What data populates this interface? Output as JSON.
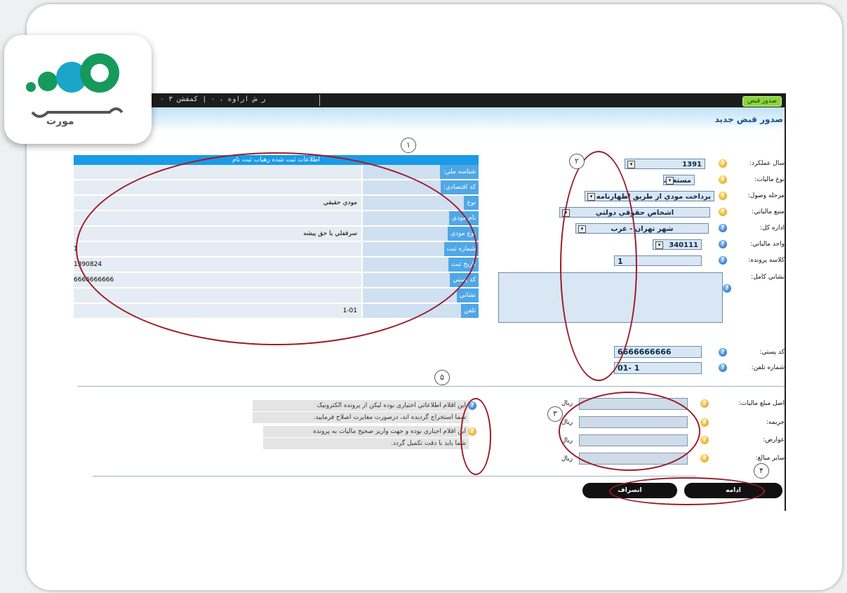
{
  "titlebar": {
    "info": "ﺭ ﺵ ﺍﺭﺍﻭﻩ ، ۰ | ﮐﻤﻔﺸﻦ ۳ ۰"
  },
  "corner_tag": "ﺻﺪﻭﺭ ﻗﺒﺾ",
  "page_title": "ﺻﺪﻭﺭ ﻗﺒﺾ ﺟﺪﻳﺪ",
  "logo": {
    "text": "ﻣﻮﺭﺕ",
    "colors": [
      "#1aa5c9",
      "#159a5b"
    ]
  },
  "form": {
    "fields": [
      {
        "label": "ﺳﺎﻝ ﻋﻤﻠﮑﺮﺩ:",
        "value": "1391"
      },
      {
        "label": "ﻧﻮﻉ ﻣﺎﻟﻴﺎﺕ:",
        "value": "ﻣﺴﺘﻐﻼﺕ"
      },
      {
        "label": "ﻣﺮﺣﻠﻪ ﻭﺻﻮﻝ:",
        "value": "ﭘﺮﺩﺍﺧﺖ ﻣﻮﺩﻱ ﺍﺯ ﻃﺮﻳﻖ ﺍﻇﻬﺎﺭﻧﺎﻣﻪ"
      },
      {
        "label": "ﻣﻨﺒﻊ ﻣﺎﻟﻴﺎﺗﻲ:",
        "value": "ﺍﺷﺨﺎﺹ ﺣﻘﻮﻗﻲ ﺩﻭﻟﺘﻲ"
      },
      {
        "label": "ﺍﺩﺍﺭﻩ ﮐﻞ:",
        "value": "ﺷﻬﺮ ﺗﻬﺮﺍﻥ - ﻏﺮﺏ"
      },
      {
        "label": "ﻭﺍﺣﺪ ﻣﺎﻟﻴﺎﺗﻲ:",
        "value": "340111"
      },
      {
        "label": "ﮐﻼﺳﻪ ﭘﺮﻭﻧﺪﻩ:",
        "value": "1"
      },
      {
        "label": "ﻧﺸﺎﻧﻲ ﮐﺎﻣﻞ:",
        "value": ""
      },
      {
        "label": "ﮐﺪ ﭘﺴﺘﻲ:",
        "value": "6666666666"
      },
      {
        "label": "ﺷﻤﺎﺭﻩ ﺗﻠﻔﻦ:",
        "value": "01- 1"
      }
    ]
  },
  "info_table": {
    "title": "ﺍﻃﻼﻋﺎﺕ ﺛﺒﺖ ﺷﺪﻩ ﺭﻫﻴﺎﺏ ﺛﺒﺖ ﻧﺎﻡ",
    "rows": [
      {
        "key": "ﺷﻨﺎﺳﻪ ﻣﻠﻲ:",
        "value": ""
      },
      {
        "key": "ﮐﺪ ﺍﻗﺘﺼﺎﺩﻱ:",
        "value": ""
      },
      {
        "key": "ﻧﻮﻉ",
        "value": "ﻣﻮﺩﻱ ﺣﻘﻴﻘﻲ"
      },
      {
        "key": "ﻧﺎﻡ ﻣﻮﺩﻱ",
        "value": ""
      },
      {
        "key": "ﻧﻮﻉ ﻣﻮﺩﻱ",
        "value": "ﺳﺮﻗﻔﻠﻲ ﻳﺎ ﺣﻖ ﭘﻴﺸﻪ"
      },
      {
        "key": "ﺷﻤﺎﺭﻩ ﺛﺒﺖ",
        "value": "1"
      },
      {
        "key": "ﺗﺎﺭﻳﺦ ﺛﺒﺖ",
        "value": "1390824"
      },
      {
        "key": "ﮐﺪ ﭘﺴﺘﻲ",
        "value": "6666666666"
      },
      {
        "key": "ﻧﺸﺎﻧﻲ",
        "value": ""
      },
      {
        "key": "ﺗﻠﻔﻦ",
        "value": "1-01"
      }
    ]
  },
  "notes": [
    "ﺍﻳﻦ ﺍﻗﻼﻡ ﺍﻃﻼﻋﺎﺗﻲ ﺍﺧﺘﻴﺎﺭﻱ ﺑﻮﺩﻩ ﻟﻴﮑﻦ ﺍﺯ ﭘﺮﻭﻧﺪﻩ ﺍﻟﮑﺘﺮﻭﻧﻴﮏ",
    "ﺷﻤﺎ ﺍﺳﺘﺨﺮﺍﺝ ﮔﺮﺩﻳﺪﻩ ﺍﻧﺪ، ﺩﺭﺻﻮﺭﺕ ﻣﻐﺎﻳﺮﺕ ﺍﺻﻼﺡ ﻓﺮﻣﺎﻳﻴﺪ.",
    "ﺍﻳﻦ ﺍﻗﻼﻡ ﺍﺟﺒﺎﺭﻱ ﺑﻮﺩﻩ ﻭ ﺟﻬﺖ ﻭﺍﺭﻳﺰ ﺻﺤﻴﺢ ﻣﺎﻟﻴﺎﺕ ﺑﻪ ﭘﺮﻭﻧﺪﻩ",
    "ﺷﻤﺎ ﺑﺎﻳﺪ ﺑﺎ ﺩﻗﺖ ﺗﮑﻤﻴﻞ ﮔﺮﺩﺩ."
  ],
  "amounts": [
    {
      "label": "ﺍﺻﻞ ﻣﺒﻠﻎ ﻣﺎﻟﻴﺎﺕ:",
      "unit": "ﺭﻳﺎﻝ"
    },
    {
      "label": "ﺟﺮﻳﻤﻪ:",
      "unit": "ﺭﻳﺎﻝ"
    },
    {
      "label": "ﻋﻮﺍﺭﺽ:",
      "unit": "ﺭﻳﺎﻝ"
    },
    {
      "label": "ﺳﺎﻳﺮ ﻣﺒﺎﻟﻎ:",
      "unit": "ﺭﻳﺎﻝ"
    }
  ],
  "buttons": {
    "continue": "ﺍﺩﺍﻣﻪ",
    "cancel": "ﺍﻧﺼﺮﺍﻑ"
  },
  "annotation_numbers": [
    "۱",
    "۲",
    "۳",
    "۴",
    "۵"
  ],
  "annotation_color": "#9b1c2a"
}
